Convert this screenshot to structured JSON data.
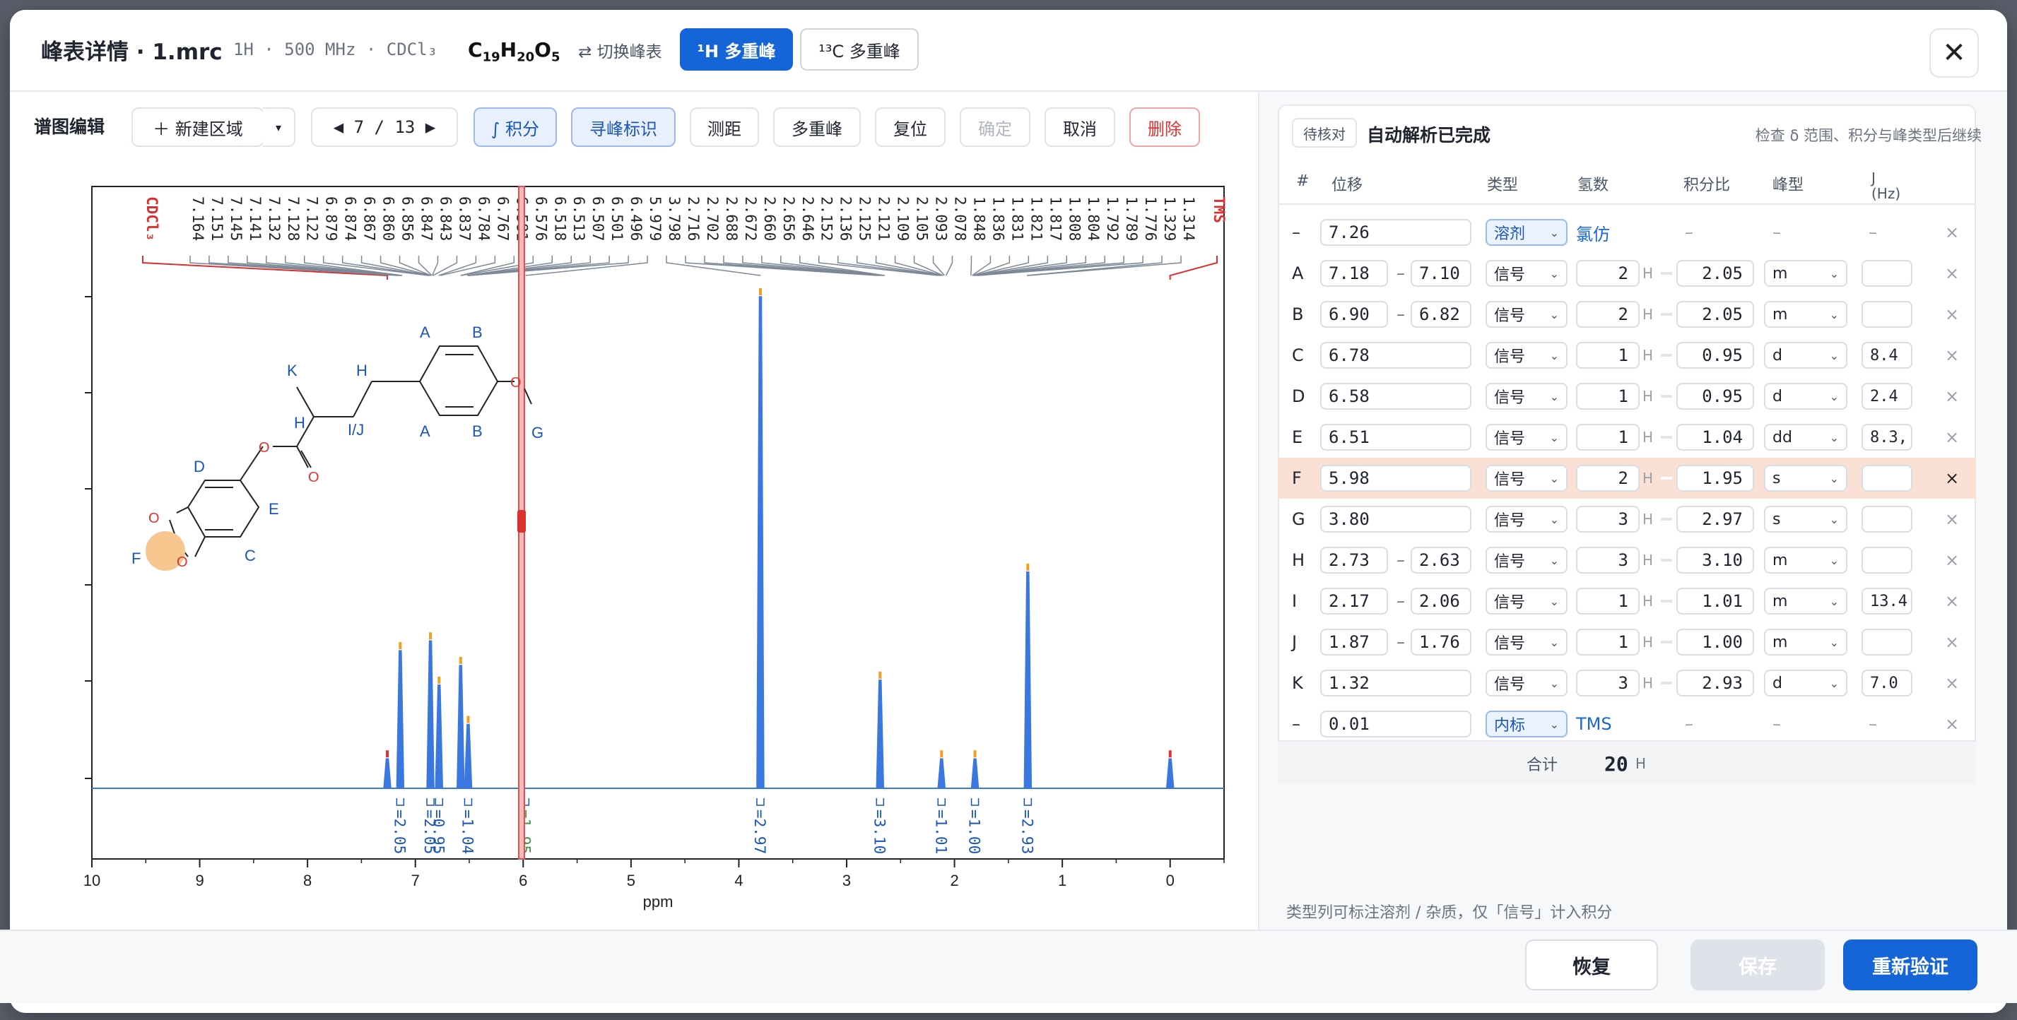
{
  "header": {
    "title": "峰表详情 · 1.mrc",
    "meta": "1H · 500 MHz · CDCl₃",
    "formula_parts": [
      "C",
      "19",
      "H",
      "20",
      "O",
      "5"
    ],
    "switch_label": "⇄ 切换峰表",
    "tab_h": "¹H 多重峰",
    "tab_c": "¹³C 多重峰",
    "close": "✕"
  },
  "toolbar": {
    "label": "谱图编辑",
    "new_region": "＋ 新建区域",
    "dropdown": "▾",
    "nav": "◀  7 / 13  ▶",
    "integrate": "∫ 积分",
    "peak_pick": "寻峰标识",
    "measure": "测距",
    "multiplet": "多重峰",
    "reset": "复位",
    "confirm": "确定",
    "cancel": "取消",
    "delete": "删除"
  },
  "colors": {
    "accent": "#1565d8",
    "spectrum": "#3a78e0",
    "peak_marker": "#f0a020",
    "highlight_row": "#fbe0d6",
    "danger": "#e03131",
    "cursor": "#e05050"
  },
  "spectrum": {
    "xlabel": "ppm",
    "xticks": [
      "10",
      "9",
      "8",
      "7",
      "6",
      "5",
      "4",
      "3",
      "2",
      "1",
      "0"
    ],
    "peak_labels": [
      "7.164",
      "7.151",
      "7.145",
      "7.141",
      "7.132",
      "7.128",
      "7.122",
      "6.879",
      "6.874",
      "6.867",
      "6.860",
      "6.856",
      "6.847",
      "6.843",
      "6.837",
      "6.784",
      "6.767",
      "6.581",
      "6.576",
      "6.518",
      "6.513",
      "6.507",
      "6.501",
      "6.496",
      "5.979",
      "3.798",
      "2.716",
      "2.702",
      "2.688",
      "2.672",
      "2.660",
      "2.656",
      "2.646",
      "2.152",
      "2.136",
      "2.125",
      "2.121",
      "2.109",
      "2.105",
      "2.093",
      "2.078",
      "1.848",
      "1.836",
      "1.831",
      "1.821",
      "1.817",
      "1.808",
      "1.804",
      "1.792",
      "1.789",
      "1.776",
      "1.329",
      "1.314"
    ],
    "ref_left": "CDCl₃",
    "ref_right": "TMS",
    "integrals": [
      "2.05",
      "2.05",
      "0.95",
      "1.04",
      "1.95",
      "2.97",
      "3.10",
      "1.01",
      "1.00",
      "2.93"
    ],
    "peaks": [
      {
        "ppm": 7.26,
        "h": 0.06
      },
      {
        "ppm": 7.14,
        "h": 0.28
      },
      {
        "ppm": 6.86,
        "h": 0.3
      },
      {
        "ppm": 6.78,
        "h": 0.21
      },
      {
        "ppm": 6.58,
        "h": 0.25
      },
      {
        "ppm": 6.51,
        "h": 0.13
      },
      {
        "ppm": 3.8,
        "h": 1.0
      },
      {
        "ppm": 2.69,
        "h": 0.22
      },
      {
        "ppm": 2.12,
        "h": 0.06
      },
      {
        "ppm": 1.81,
        "h": 0.06
      },
      {
        "ppm": 1.32,
        "h": 0.44
      },
      {
        "ppm": 0.0,
        "h": 0.06
      }
    ],
    "molecule_labels": {
      "A1": "A",
      "B1": "B",
      "A2": "A",
      "B2": "B",
      "H1": "H",
      "K": "K",
      "H2": "H",
      "IJ": "I/J",
      "G": "G",
      "D": "D",
      "E": "E",
      "C": "C",
      "F": "F"
    }
  },
  "panel": {
    "pending": "待核对",
    "status": "自动解析已完成",
    "hint": "检查 δ 范围、积分与峰类型后继续",
    "headers": [
      "#",
      "位移",
      "类型",
      "氢数",
      "积分比",
      "峰型",
      "J",
      "(Hz)"
    ],
    "rows": [
      {
        "id": "–",
        "shift": "7.26",
        "type": "溶剂",
        "special": "氯仿"
      },
      {
        "id": "A",
        "shift": "7.18",
        "shift2": "7.10",
        "type": "信号",
        "h": "2",
        "ratio": "2.05",
        "mult": "m",
        "j": ""
      },
      {
        "id": "B",
        "shift": "6.90",
        "shift2": "6.82",
        "type": "信号",
        "h": "2",
        "ratio": "2.05",
        "mult": "m",
        "j": ""
      },
      {
        "id": "C",
        "shift": "6.78",
        "type": "信号",
        "h": "1",
        "ratio": "0.95",
        "mult": "d",
        "j": "8.4"
      },
      {
        "id": "D",
        "shift": "6.58",
        "type": "信号",
        "h": "1",
        "ratio": "0.95",
        "mult": "d",
        "j": "2.4"
      },
      {
        "id": "E",
        "shift": "6.51",
        "type": "信号",
        "h": "1",
        "ratio": "1.04",
        "mult": "dd",
        "j": "8.3,"
      },
      {
        "id": "F",
        "shift": "5.98",
        "type": "信号",
        "h": "2",
        "ratio": "1.95",
        "mult": "s",
        "j": ""
      },
      {
        "id": "G",
        "shift": "3.80",
        "type": "信号",
        "h": "3",
        "ratio": "2.97",
        "mult": "s",
        "j": ""
      },
      {
        "id": "H",
        "shift": "2.73",
        "shift2": "2.63",
        "type": "信号",
        "h": "3",
        "ratio": "3.10",
        "mult": "m",
        "j": ""
      },
      {
        "id": "I",
        "shift": "2.17",
        "shift2": "2.06",
        "type": "信号",
        "h": "1",
        "ratio": "1.01",
        "mult": "m",
        "j": "13.4"
      },
      {
        "id": "J",
        "shift": "1.87",
        "shift2": "1.76",
        "type": "信号",
        "h": "1",
        "ratio": "1.00",
        "mult": "m",
        "j": ""
      },
      {
        "id": "K",
        "shift": "1.32",
        "type": "信号",
        "h": "3",
        "ratio": "2.93",
        "mult": "d",
        "j": "7.0"
      },
      {
        "id": "–",
        "shift": "0.01",
        "type": "内标",
        "special": "TMS"
      }
    ],
    "total_label": "合计",
    "total_value": "20",
    "total_unit": "H",
    "h_unit": "H",
    "range_sep": "–",
    "dash": "–",
    "remove": "×",
    "footnote": "类型列可标注溶剂 / 杂质，仅「信号」计入积分"
  },
  "footer": {
    "restore": "恢复",
    "save": "保存",
    "revalidate": "重新验证"
  }
}
